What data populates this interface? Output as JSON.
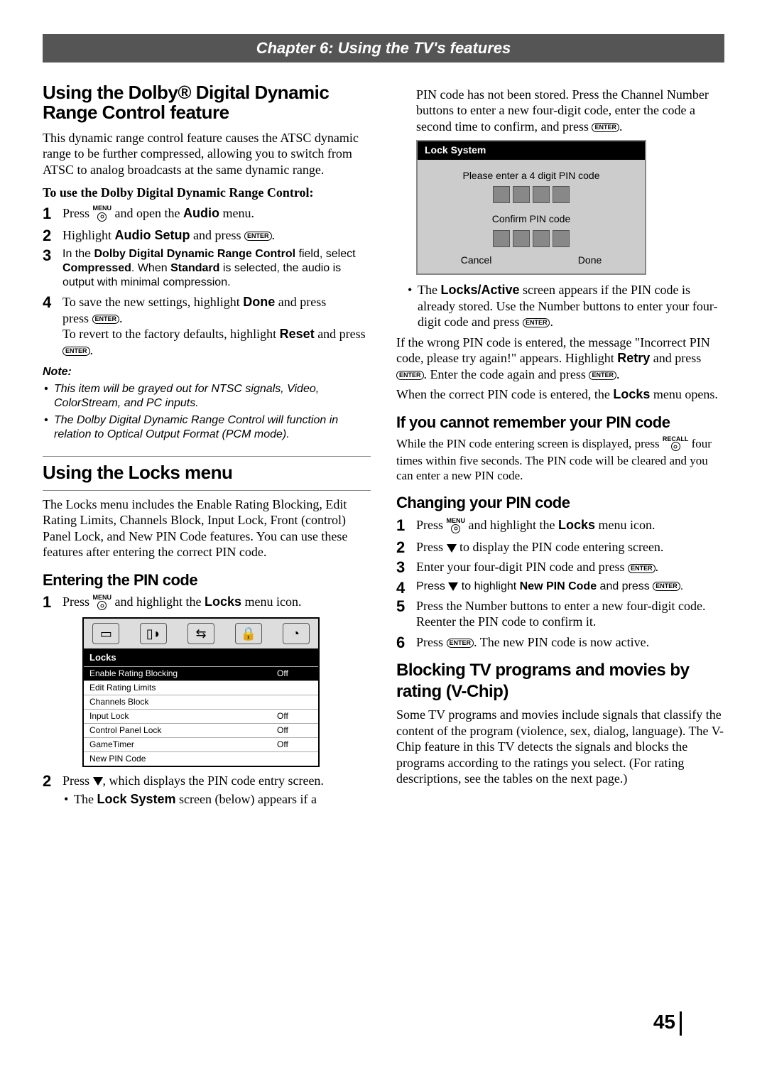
{
  "chapter_bar": "Chapter 6: Using the TV's features",
  "icons": {
    "enter": "ENTER",
    "menu": "MENU",
    "recall": "RECALL"
  },
  "left": {
    "h1": "Using the Dolby® Digital Dynamic Range Control feature",
    "intro": "This dynamic range control feature causes the ATSC dynamic range to be further compressed, allowing you to switch from ATSC to analog broadcasts at the same dynamic range.",
    "instr_head": "To use the Dolby Digital Dynamic Range Control:",
    "s1_a": "Press ",
    "s1_b": " and open the ",
    "s1_audio": "Audio",
    "s1_c": " menu.",
    "s2_a": "Highlight ",
    "s2_setup": "Audio Setup",
    "s2_b": " and press ",
    "s3_a": "In the ",
    "s3_field": "Dolby Digital Dynamic Range Control",
    "s3_b": " field, select ",
    "s3_comp": "Compressed",
    "s3_c": ". When ",
    "s3_std": "Standard",
    "s3_d": " is selected, the audio is output with minimal compression.",
    "s4_a": "To save the new settings, highlight ",
    "s4_done": "Done",
    "s4_b": " and press ",
    "s4_c": "To revert to the factory defaults, highlight ",
    "s4_reset": "Reset",
    "s4_d": " and press ",
    "note_head": "Note:",
    "note1": "This item will be grayed out for NTSC signals, Video, ColorStream, and PC inputs.",
    "note2": "The Dolby Digital Dynamic Range Control will function in relation to Optical Output Format (PCM mode).",
    "h1b": "Using the Locks menu",
    "locks_intro": "The Locks menu includes the Enable Rating Blocking, Edit Rating Limits, Channels Block, Input Lock, Front (control) Panel Lock, and New PIN Code features. You can use these features after entering the correct PIN code.",
    "h2_enter": "Entering the PIN code",
    "ep_s1_a": "Press ",
    "ep_s1_b": " and highlight the ",
    "ep_s1_locks": "Locks",
    "ep_s1_c": " menu icon.",
    "locks_panel": {
      "title": "Locks",
      "rows": [
        {
          "label": "Enable Rating Blocking",
          "val": "Off",
          "sel": true
        },
        {
          "label": "Edit Rating Limits",
          "val": "",
          "sel": false
        },
        {
          "label": "Channels Block",
          "val": "",
          "sel": false
        },
        {
          "label": "Input Lock",
          "val": "Off",
          "sel": false
        },
        {
          "label": "Control Panel Lock",
          "val": "Off",
          "sel": false
        },
        {
          "label": "GameTimer",
          "val": "Off",
          "sel": false
        },
        {
          "label": "New PIN Code",
          "val": "",
          "sel": false
        }
      ]
    },
    "ep_s2_a": "Press ",
    "ep_s2_b": ", which displays the PIN code entry screen.",
    "ep_bullet_a": "The ",
    "ep_bullet_ls": "Lock System",
    "ep_bullet_b": " screen (below) appears if a"
  },
  "right": {
    "cont_a": "PIN code has not been stored. Press the Channel Number buttons to enter a new four-digit code, enter the code a second time to confirm, and press ",
    "pin_panel": {
      "title": "Lock System",
      "msg1": "Please enter a 4 digit PIN code",
      "msg2": "Confirm PIN code",
      "btn1": "Cancel",
      "btn2": "Done"
    },
    "b1_a": "The ",
    "b1_la": "Locks/Active",
    "b1_b": " screen appears if the PIN code is already stored. Use the Number buttons to enter your four-digit code and press ",
    "wrong_a": "If the wrong PIN code is entered, the message \"Incorrect PIN code, please try again!\" appears. Highlight ",
    "wrong_retry": "Retry",
    "wrong_b": " and press ",
    "wrong_c": ". Enter the code again and press ",
    "correct_a": "When the correct PIN code is entered, the ",
    "correct_locks": "Locks",
    "correct_b": " menu opens.",
    "h2_forgot": "If you cannot remember your PIN code",
    "forgot_a": "While the PIN code entering screen is displayed, press ",
    "forgot_b": " four times within five seconds. The PIN code will be cleared and you can enter a new PIN code.",
    "h2_change": "Changing your PIN code",
    "c1_a": "Press ",
    "c1_b": " and highlight the ",
    "c1_locks": "Locks",
    "c1_c": " menu icon.",
    "c2_a": "Press ",
    "c2_b": " to display the PIN code entering screen.",
    "c3_a": "Enter your four-digit PIN code and press ",
    "c4_a": "Press ",
    "c4_b": " to highlight ",
    "c4_npc": "New PIN Code",
    "c4_c": " and press ",
    "c5": "Press the Number buttons to enter a new four-digit code. Reenter the PIN code to confirm it.",
    "c6_a": "Press ",
    "c6_b": ". The new PIN code is now active.",
    "h2_vchip": "Blocking TV programs and movies by rating (V-Chip)",
    "vchip_p": "Some TV programs and movies include signals that classify the content of the program (violence, sex, dialog, language). The V-Chip feature in this TV detects the signals and blocks the programs according to the ratings you select. (For rating descriptions, see the tables on the next page.)"
  },
  "page_number": "45"
}
